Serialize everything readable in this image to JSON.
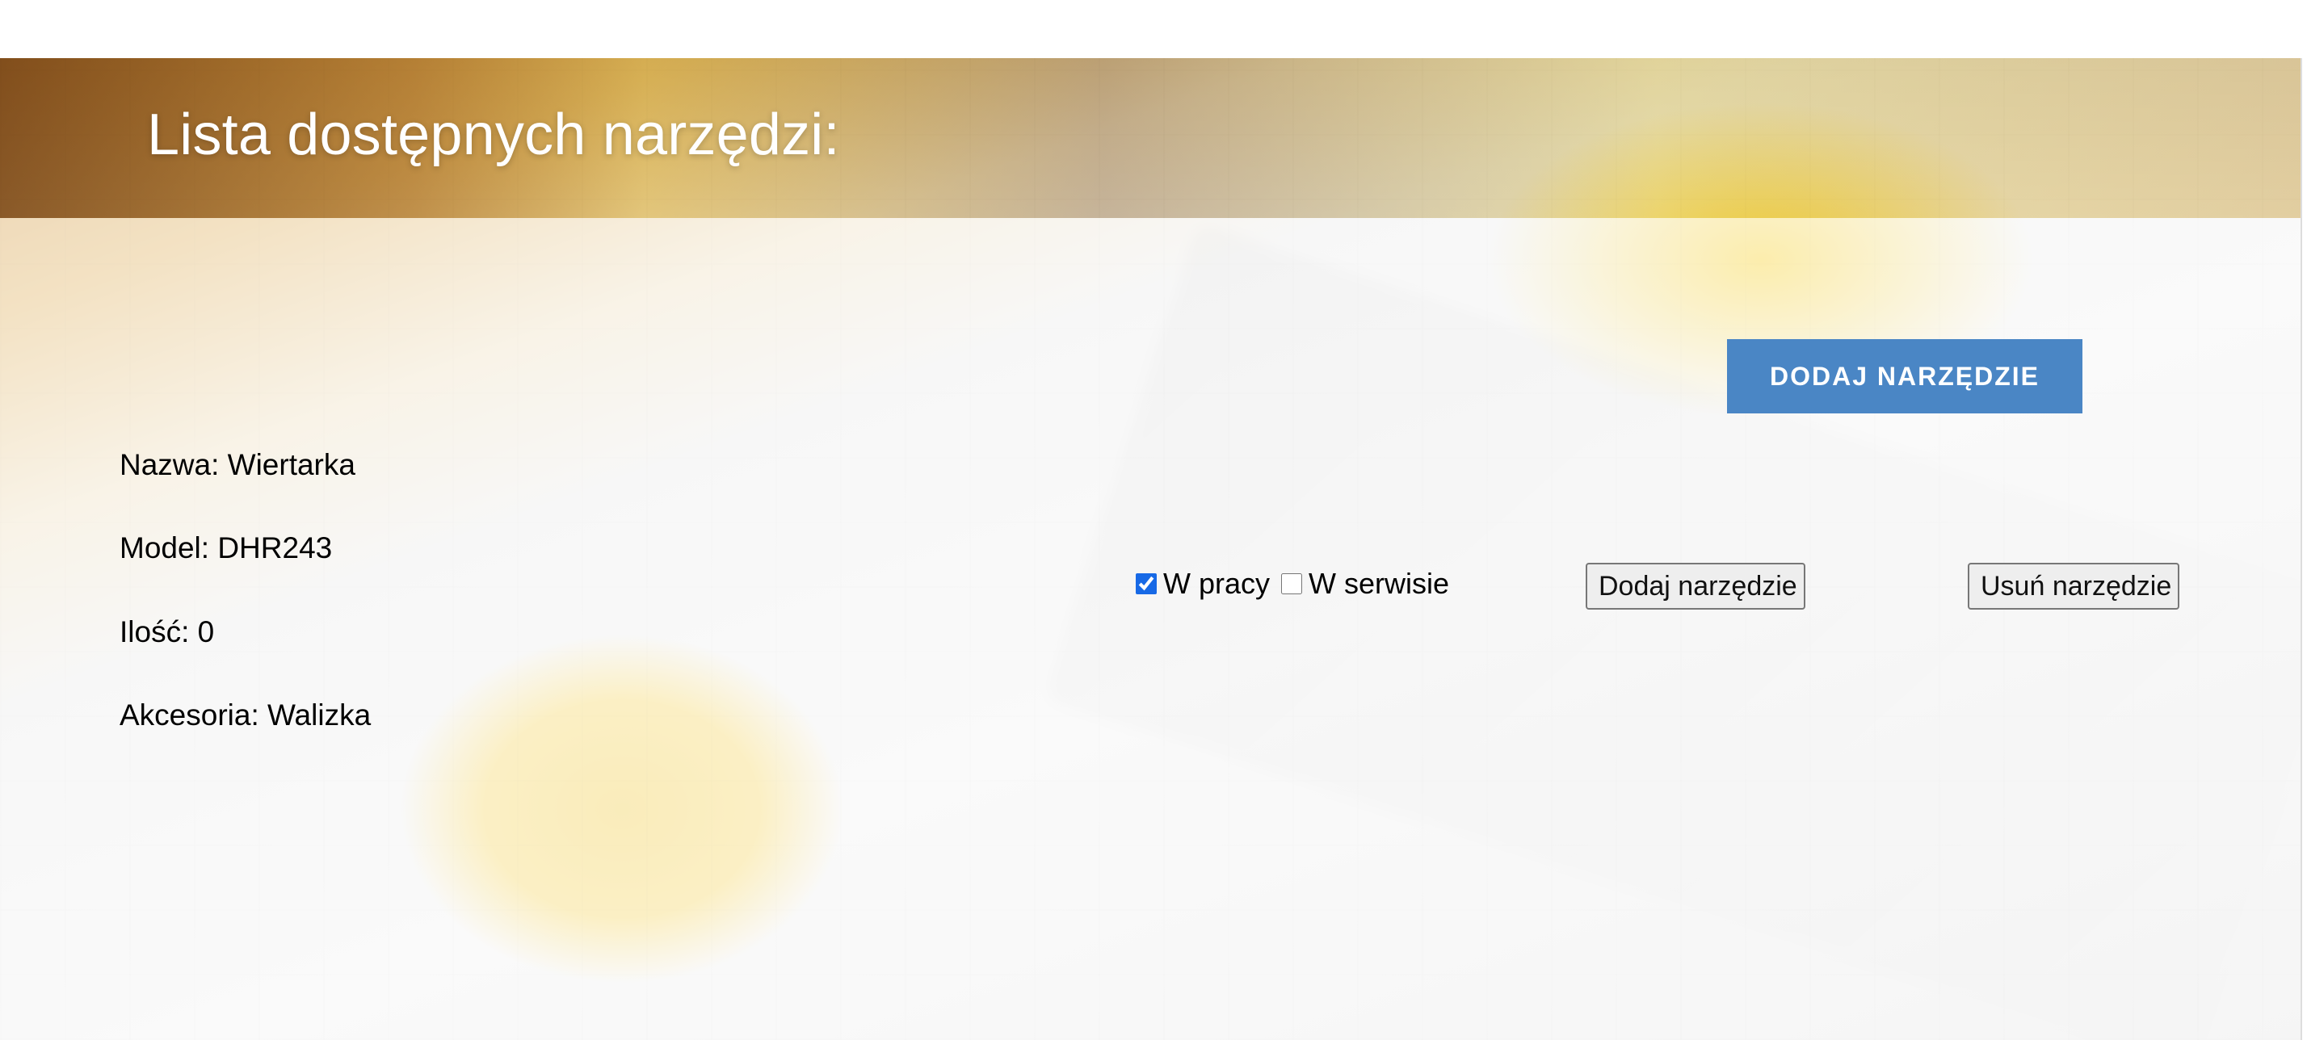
{
  "header": {
    "title": "Lista dostępnych narzędzi:"
  },
  "toolbar": {
    "add_tool_label": "DODAJ NARZĘDZIE"
  },
  "tool": {
    "name_line": "Nazwa: Wiertarka",
    "model_line": "Model: DHR243",
    "quantity_line": "Ilość: 0",
    "accessories_line": "Akcesoria: Walizka",
    "statuses": {
      "in_work_label": "W pracy",
      "in_service_label": "W serwisie",
      "in_work_checked": true,
      "in_service_checked": false
    },
    "actions": {
      "add_label": "Dodaj narzędzie",
      "remove_label": "Usuń narzędzie"
    }
  },
  "colors": {
    "primary_button": "#4a86c5",
    "checkbox_accent": "#1769e6",
    "title_text": "#ffffff"
  }
}
